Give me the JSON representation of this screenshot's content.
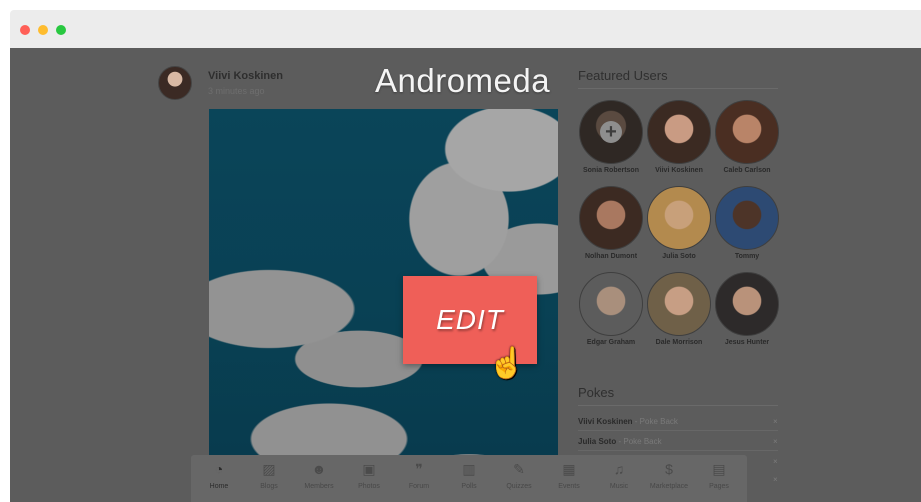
{
  "post": {
    "author": "Viivi Koskinen",
    "time": "3 minutes ago"
  },
  "brand": "Andromeda",
  "edit_button": {
    "label": "EDIT"
  },
  "sidebar": {
    "featured_title": "Featured Users",
    "users": [
      {
        "name": "Sonia Robertson",
        "icon": "plus-icon"
      },
      {
        "name": "Viivi Koskinen"
      },
      {
        "name": "Caleb Carlson"
      },
      {
        "name": "Nolhan Dumont"
      },
      {
        "name": "Julia Soto"
      },
      {
        "name": "Tommy"
      },
      {
        "name": "Edgar Graham"
      },
      {
        "name": "Dale Morrison"
      },
      {
        "name": "Jesus Hunter"
      }
    ],
    "pokes_title": "Pokes",
    "pokes": [
      {
        "name": "Viivi Koskinen",
        "action": "- Poke Back",
        "close": "×"
      },
      {
        "name": "Julia Soto",
        "action": "- Poke Back",
        "close": "×"
      },
      {
        "name": "",
        "action": "",
        "close": "×"
      },
      {
        "name": "",
        "action": "",
        "close": "×"
      }
    ]
  },
  "bottom_nav": {
    "items": [
      {
        "label": "Home",
        "icon": "dashboard-icon",
        "glyph": "◔",
        "active": true
      },
      {
        "label": "Blogs",
        "icon": "blog-icon",
        "glyph": "▨"
      },
      {
        "label": "Members",
        "icon": "members-icon",
        "glyph": "☻"
      },
      {
        "label": "Photos",
        "icon": "photos-icon",
        "glyph": "▣"
      },
      {
        "label": "Forum",
        "icon": "forum-icon",
        "glyph": "❞"
      },
      {
        "label": "Polls",
        "icon": "polls-icon",
        "glyph": "▥"
      },
      {
        "label": "Quizzes",
        "icon": "quizzes-icon",
        "glyph": "✎"
      },
      {
        "label": "Events",
        "icon": "events-icon",
        "glyph": "▦"
      },
      {
        "label": "Music",
        "icon": "music-icon",
        "glyph": "♫"
      },
      {
        "label": "Marketplace",
        "icon": "marketplace-icon",
        "glyph": "$"
      },
      {
        "label": "Pages",
        "icon": "pages-icon",
        "glyph": "▤"
      }
    ]
  }
}
